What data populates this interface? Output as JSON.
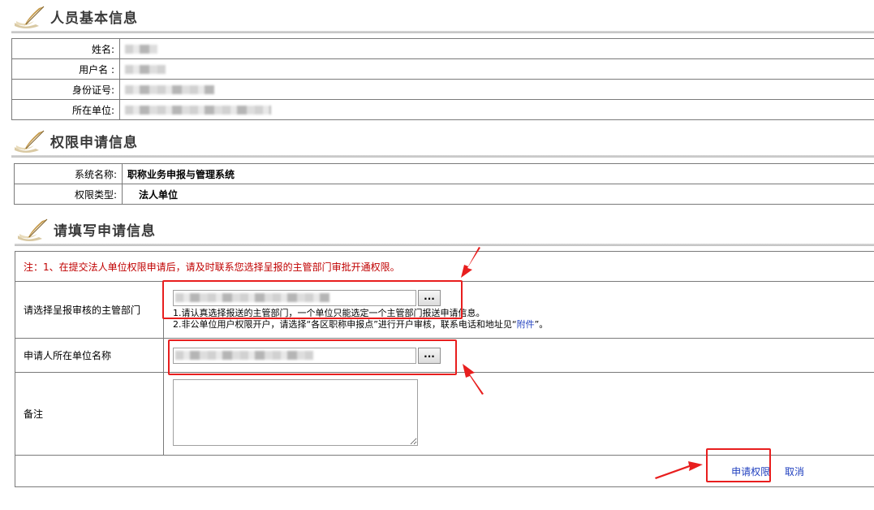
{
  "sections": {
    "personal": "人员基本信息",
    "permission": "权限申请信息",
    "apply": "请填写申请信息"
  },
  "personal_info": {
    "name_label": "姓名:",
    "username_label": "用户名 :",
    "idcard_label": "身份证号:",
    "unit_label": "所在单位:"
  },
  "permission_info": {
    "system_label": "系统名称:",
    "system_value": "职称业务申报与管理系统",
    "type_label": "权限类型:",
    "type_value": "法人单位"
  },
  "apply_form": {
    "notice": "注：1、在提交法人单位权限申请后，请及时联系您选择呈报的主管部门审批开通权限。",
    "dept_label": "请选择呈报审核的主管部门",
    "picker_button": "...",
    "hint1": "1.请认真选择报送的主管部门，一个单位只能选定一个主管部门报送申请信息。",
    "hint2_prefix": "2.非公单位用户权限开户，请选择“各区职称申报点”进行开户审核，联系电话和地址见“",
    "hint2_link": "附件",
    "hint2_suffix": "”。",
    "applicant_unit_label": "申请人所在单位名称",
    "remark_label": "备注",
    "submit_label": "申请权限",
    "cancel_label": "取消"
  },
  "colors": {
    "annotation": "#e81e1e",
    "notice": "#c00000",
    "link": "#1f3fbf"
  }
}
